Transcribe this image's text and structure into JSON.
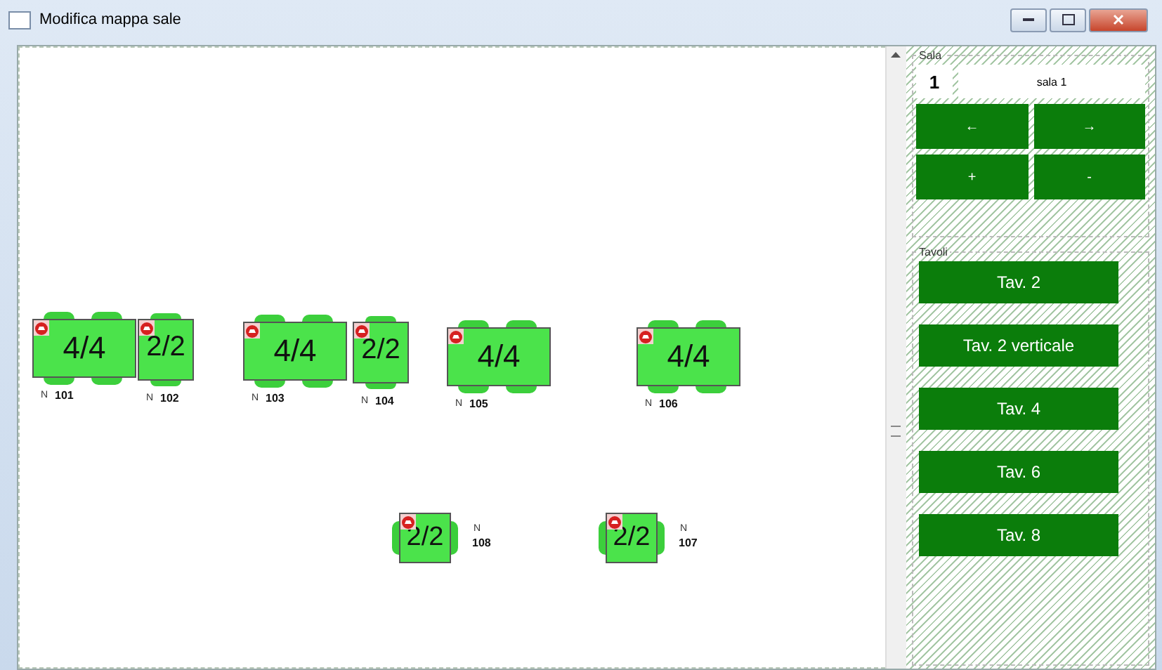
{
  "window": {
    "title": "Modifica mappa sale"
  },
  "tables": [
    {
      "kind": "wide",
      "occupancy": "4/4",
      "prefix": "N",
      "number": "101"
    },
    {
      "kind": "narrow",
      "occupancy": "2/2",
      "prefix": "N",
      "number": "102"
    },
    {
      "kind": "wide",
      "occupancy": "4/4",
      "prefix": "N",
      "number": "103"
    },
    {
      "kind": "narrow",
      "occupancy": "2/2",
      "prefix": "N",
      "number": "104"
    },
    {
      "kind": "wide",
      "occupancy": "4/4",
      "prefix": "N",
      "number": "105"
    },
    {
      "kind": "wide",
      "occupancy": "4/4",
      "prefix": "N",
      "number": "106"
    },
    {
      "kind": "vertical",
      "occupancy": "2/2",
      "prefix": "N",
      "number": "108"
    },
    {
      "kind": "vertical",
      "occupancy": "2/2",
      "prefix": "N",
      "number": "107"
    }
  ],
  "sala": {
    "title": "Sala",
    "number": "1",
    "name": "sala 1",
    "buttons": [
      "←",
      "→",
      "+",
      "-"
    ]
  },
  "tavoli": {
    "title": "Tavoli",
    "buttons": [
      "Tav. 2",
      "Tav. 2 verticale",
      "Tav. 4",
      "Tav. 6",
      "Tav. 8"
    ]
  }
}
